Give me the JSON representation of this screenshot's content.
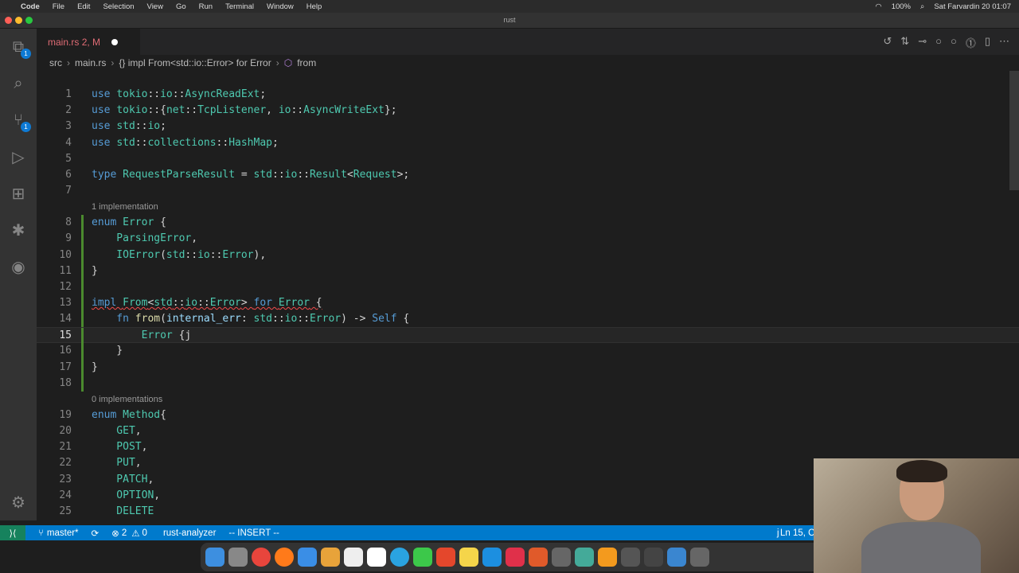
{
  "menubar": {
    "app": "Code",
    "items": [
      "File",
      "Edit",
      "Selection",
      "View",
      "Go",
      "Run",
      "Terminal",
      "Window",
      "Help"
    ],
    "battery": "100%",
    "clock": "Sat Farvardin 20  01:07"
  },
  "window": {
    "title": "rust"
  },
  "activity": {
    "explorer_badge": "1",
    "scm_badge": "1"
  },
  "tab": {
    "filename": "main.rs",
    "status": "2, M"
  },
  "breadcrumb": [
    "src",
    "main.rs",
    "{} impl From<std::io::Error> for Error",
    "from"
  ],
  "editor": {
    "rows": [
      {
        "n": "1",
        "c": [
          [
            "use ",
            "k"
          ],
          [
            "tokio",
            "t"
          ],
          [
            "::",
            "p"
          ],
          [
            "io",
            "t"
          ],
          [
            "::",
            "p"
          ],
          [
            "AsyncReadExt",
            "t"
          ],
          [
            ";",
            "p"
          ]
        ]
      },
      {
        "n": "2",
        "c": [
          [
            "use ",
            "k"
          ],
          [
            "tokio",
            "t"
          ],
          [
            "::{",
            "p"
          ],
          [
            "net",
            "t"
          ],
          [
            "::",
            "p"
          ],
          [
            "TcpListener",
            "t"
          ],
          [
            ", ",
            "p"
          ],
          [
            "io",
            "t"
          ],
          [
            "::",
            "p"
          ],
          [
            "AsyncWriteExt",
            "t"
          ],
          [
            "};",
            "p"
          ]
        ]
      },
      {
        "n": "3",
        "c": [
          [
            "use ",
            "k"
          ],
          [
            "std",
            "t"
          ],
          [
            "::",
            "p"
          ],
          [
            "io",
            "t"
          ],
          [
            ";",
            "p"
          ]
        ]
      },
      {
        "n": "4",
        "c": [
          [
            "use ",
            "k"
          ],
          [
            "std",
            "t"
          ],
          [
            "::",
            "p"
          ],
          [
            "collections",
            "t"
          ],
          [
            "::",
            "p"
          ],
          [
            "HashMap",
            "t"
          ],
          [
            ";",
            "p"
          ]
        ]
      },
      {
        "n": "5",
        "c": []
      },
      {
        "n": "6",
        "c": [
          [
            "type ",
            "k"
          ],
          [
            "RequestParseResult",
            "t"
          ],
          [
            " = ",
            "p"
          ],
          [
            "std",
            "t"
          ],
          [
            "::",
            "p"
          ],
          [
            "io",
            "t"
          ],
          [
            "::",
            "p"
          ],
          [
            "Result",
            "t"
          ],
          [
            "<",
            "p"
          ],
          [
            "Request",
            "t"
          ],
          [
            ">;",
            "p"
          ]
        ]
      },
      {
        "n": "7",
        "c": []
      },
      {
        "lens": "1 implementation"
      },
      {
        "n": "8",
        "c": [
          [
            "enum ",
            "k"
          ],
          [
            "Error",
            "t"
          ],
          [
            " {",
            "p"
          ]
        ]
      },
      {
        "n": "9",
        "c": [
          [
            "    ParsingError",
            "t"
          ],
          [
            ",",
            "p"
          ]
        ]
      },
      {
        "n": "10",
        "c": [
          [
            "    IOError",
            "t"
          ],
          [
            "(",
            "p"
          ],
          [
            "std",
            "t"
          ],
          [
            "::",
            "p"
          ],
          [
            "io",
            "t"
          ],
          [
            "::",
            "p"
          ],
          [
            "Error",
            "t"
          ],
          [
            "),",
            "p"
          ]
        ]
      },
      {
        "n": "11",
        "c": [
          [
            "}",
            "p"
          ]
        ]
      },
      {
        "n": "12",
        "c": []
      },
      {
        "n": "13",
        "sq": true,
        "c": [
          [
            "impl ",
            "k"
          ],
          [
            "From",
            "t"
          ],
          [
            "<",
            "p"
          ],
          [
            "std",
            "t"
          ],
          [
            "::",
            "p"
          ],
          [
            "io",
            "t"
          ],
          [
            "::",
            "p"
          ],
          [
            "Error",
            "t"
          ],
          [
            "> ",
            "p"
          ],
          [
            "for ",
            "k"
          ],
          [
            "Error",
            "t"
          ],
          [
            " {",
            "p"
          ]
        ]
      },
      {
        "n": "14",
        "c": [
          [
            "    fn ",
            "k"
          ],
          [
            "from",
            "f"
          ],
          [
            "(",
            "p"
          ],
          [
            "internal_err",
            "v"
          ],
          [
            ": ",
            "p"
          ],
          [
            "std",
            "t"
          ],
          [
            "::",
            "p"
          ],
          [
            "io",
            "t"
          ],
          [
            "::",
            "p"
          ],
          [
            "Error",
            "t"
          ],
          [
            ") -> ",
            "p"
          ],
          [
            "Self",
            "k"
          ],
          [
            " {",
            "p"
          ]
        ]
      },
      {
        "n": "15",
        "cur": true,
        "c": [
          [
            "        Error",
            "t"
          ],
          [
            " {j",
            "p"
          ]
        ]
      },
      {
        "n": "16",
        "c": [
          [
            "    }",
            "p"
          ]
        ]
      },
      {
        "n": "17",
        "c": [
          [
            "}",
            "p"
          ]
        ]
      },
      {
        "n": "18",
        "c": []
      },
      {
        "lens": "0 implementations"
      },
      {
        "n": "19",
        "c": [
          [
            "enum ",
            "k"
          ],
          [
            "Method",
            "t"
          ],
          [
            "{",
            "p"
          ]
        ]
      },
      {
        "n": "20",
        "c": [
          [
            "    GET",
            "t"
          ],
          [
            ",",
            "p"
          ]
        ]
      },
      {
        "n": "21",
        "c": [
          [
            "    POST",
            "t"
          ],
          [
            ",",
            "p"
          ]
        ]
      },
      {
        "n": "22",
        "c": [
          [
            "    PUT",
            "t"
          ],
          [
            ",",
            "p"
          ]
        ]
      },
      {
        "n": "23",
        "c": [
          [
            "    PATCH",
            "t"
          ],
          [
            ",",
            "p"
          ]
        ]
      },
      {
        "n": "24",
        "c": [
          [
            "    OPTION",
            "t"
          ],
          [
            ",",
            "p"
          ]
        ]
      },
      {
        "n": "25",
        "c": [
          [
            "    DELETE",
            "t"
          ]
        ]
      }
    ]
  },
  "status": {
    "branch": "master*",
    "errors": "2",
    "warnings": "0",
    "lsp": "rust-analyzer",
    "mode": "-- INSERT --",
    "key": "j",
    "position": "Ln 15, C"
  }
}
